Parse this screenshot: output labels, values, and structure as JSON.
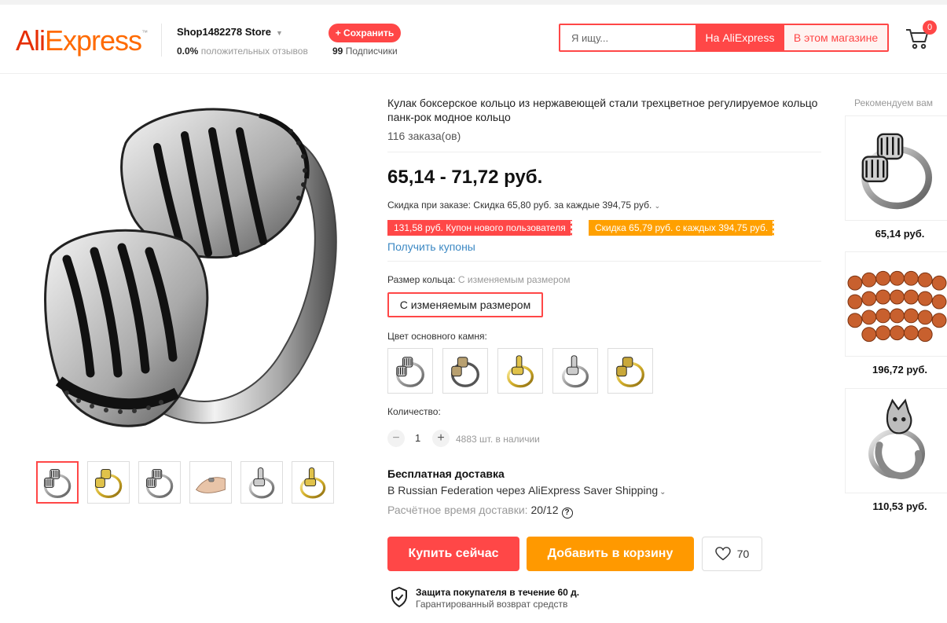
{
  "header": {
    "logo_text_1": "Ali",
    "logo_text_2": "Express",
    "logo_tm": "™",
    "store_name": "Shop1482278 Store",
    "rating_value": "0.0%",
    "rating_label": "положительных отзывов",
    "save_label": "+ Сохранить",
    "subs_count": "99",
    "subs_label": "Подписчики",
    "search_placeholder": "Я ищу...",
    "search_ali_label": "На AliExpress",
    "search_store_label": "В этом магазине",
    "cart_count": "0"
  },
  "product": {
    "title": "Кулак боксерское кольцо из нержавеющей стали трехцветное регулируемое кольцо панк-рок модное кольцо",
    "orders": "116 заказа(ов)",
    "price": "65,14 - 71,72 руб.",
    "discount_text": "Скидка при заказе: Скидка 65,80 руб. за каждые 394,75 руб.",
    "coupon_new_user": "131,58 руб. Купон нового пользователя",
    "coupon_discount": "Скидка 65,79 руб. с каждых 394,75 руб.",
    "get_coupons": "Получить купоны",
    "size_label": "Размер кольца:",
    "size_value": "С изменяемым размером",
    "size_option": "С изменяемым размером",
    "color_label": "Цвет основного камня:",
    "qty_label": "Количество:",
    "qty_value": "1",
    "stock": "4883 шт. в наличии",
    "shipping_title": "Бесплатная доставка",
    "shipping_route": "В Russian Federation через AliExpress Saver Shipping",
    "delivery_label": "Расчётное время доставки:",
    "delivery_value": "20/12",
    "buy_now": "Купить сейчас",
    "add_to_cart": "Добавить в корзину",
    "wish_count": "70",
    "protection_title": "Защита покупателя в течение 60 д.",
    "protection_sub": "Гарантированный возврат средств"
  },
  "colors": {
    "accent": "#ff4747",
    "orange": "#ff9900",
    "link": "#3b88c3"
  },
  "recommend": {
    "title": "Рекомендуем вам",
    "items": [
      {
        "price": "65,14 руб."
      },
      {
        "price": "196,72 руб."
      },
      {
        "price": "110,53 руб."
      }
    ]
  }
}
